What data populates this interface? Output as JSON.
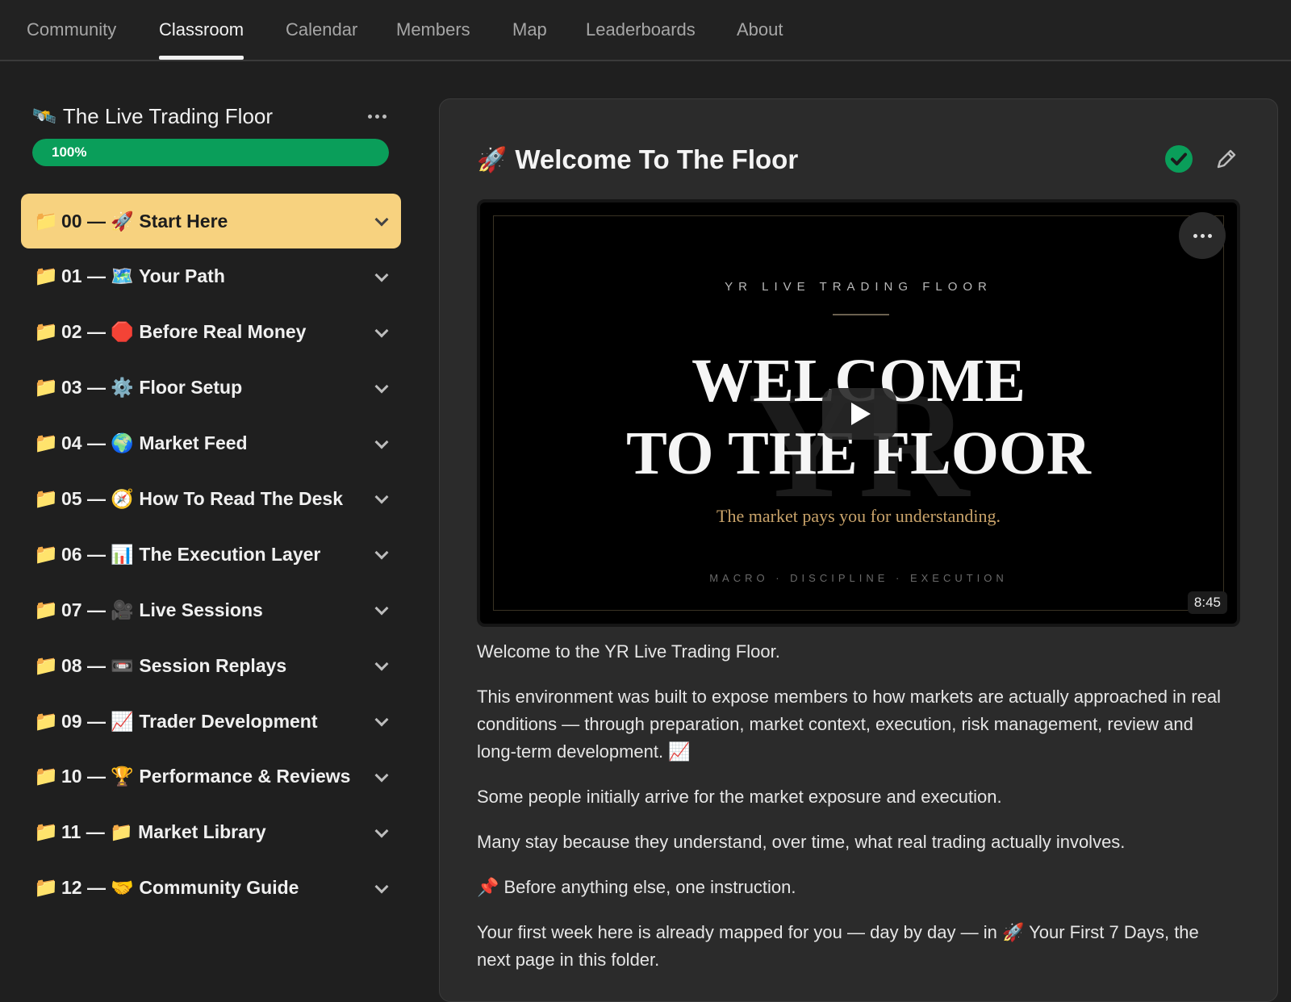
{
  "nav": {
    "tabs": [
      "Community",
      "Classroom",
      "Calendar",
      "Members",
      "Map",
      "Leaderboards",
      "About"
    ],
    "active": "Classroom"
  },
  "course": {
    "icon": "🛰️",
    "title": "The Live Trading Floor",
    "progress_label": "100%",
    "progress_value": 1.0
  },
  "modules": [
    {
      "folder": "📁",
      "label": "00 — 🚀 Start Here",
      "active": true
    },
    {
      "folder": "📁",
      "label": "01 — 🗺️ Your Path"
    },
    {
      "folder": "📁",
      "label": "02 — 🛑 Before Real Money"
    },
    {
      "folder": "📁",
      "label": "03 — ⚙️ Floor Setup"
    },
    {
      "folder": "📁",
      "label": "04 — 🌍 Market Feed"
    },
    {
      "folder": "📁",
      "label": "05 — 🧭 How To Read The Desk"
    },
    {
      "folder": "📁",
      "label": "06 — 📊 The Execution Layer"
    },
    {
      "folder": "📁",
      "label": "07 — 🎥 Live Sessions"
    },
    {
      "folder": "📁",
      "label": "08 — 📼 Session Replays"
    },
    {
      "folder": "📁",
      "label": "09 — 📈 Trader Development"
    },
    {
      "folder": "📁",
      "label": "10 — 🏆 Performance & Reviews"
    },
    {
      "folder": "📁",
      "label": "11 — 📁 Market Library"
    },
    {
      "folder": "📁",
      "label": "12 — 🤝 Community Guide"
    }
  ],
  "lesson": {
    "emoji": "🚀",
    "title": "Welcome To The Floor",
    "completed": true,
    "video": {
      "kicker": "YR LIVE TRADING FLOOR",
      "watermark": "YR",
      "title_line1": "WELCOME",
      "title_line2": "TO THE FLOOR",
      "subtitle": "The market pays you for understanding.",
      "footer": "MACRO · DISCIPLINE · EXECUTION",
      "duration": "8:45"
    },
    "paragraphs": [
      "Welcome to the YR Live Trading Floor.",
      "This environment was built to expose members to how markets are actually approached in real conditions — through preparation, market context, execution, risk management, review and long-term development. 📈",
      "Some people initially arrive for the market exposure and execution.",
      "Many stay because they understand, over time, what real trading actually involves.",
      "📌 Before anything else, one instruction.",
      "Your first week here is already mapped for you — day by day — in 🚀 Your First 7 Days, the next page in this folder."
    ]
  },
  "colors": {
    "accent_active_module": "#f7d27f",
    "progress_green": "#0a9e5a",
    "check_green": "#0a9e5a",
    "subtitle_gold": "#c9a36a"
  },
  "icons": {
    "course_more": "more-horizontal-icon",
    "video_more": "more-horizontal-icon",
    "complete": "check-circle-icon",
    "edit": "pencil-icon",
    "module_toggle": "chevron-down-icon",
    "play": "play-icon"
  }
}
